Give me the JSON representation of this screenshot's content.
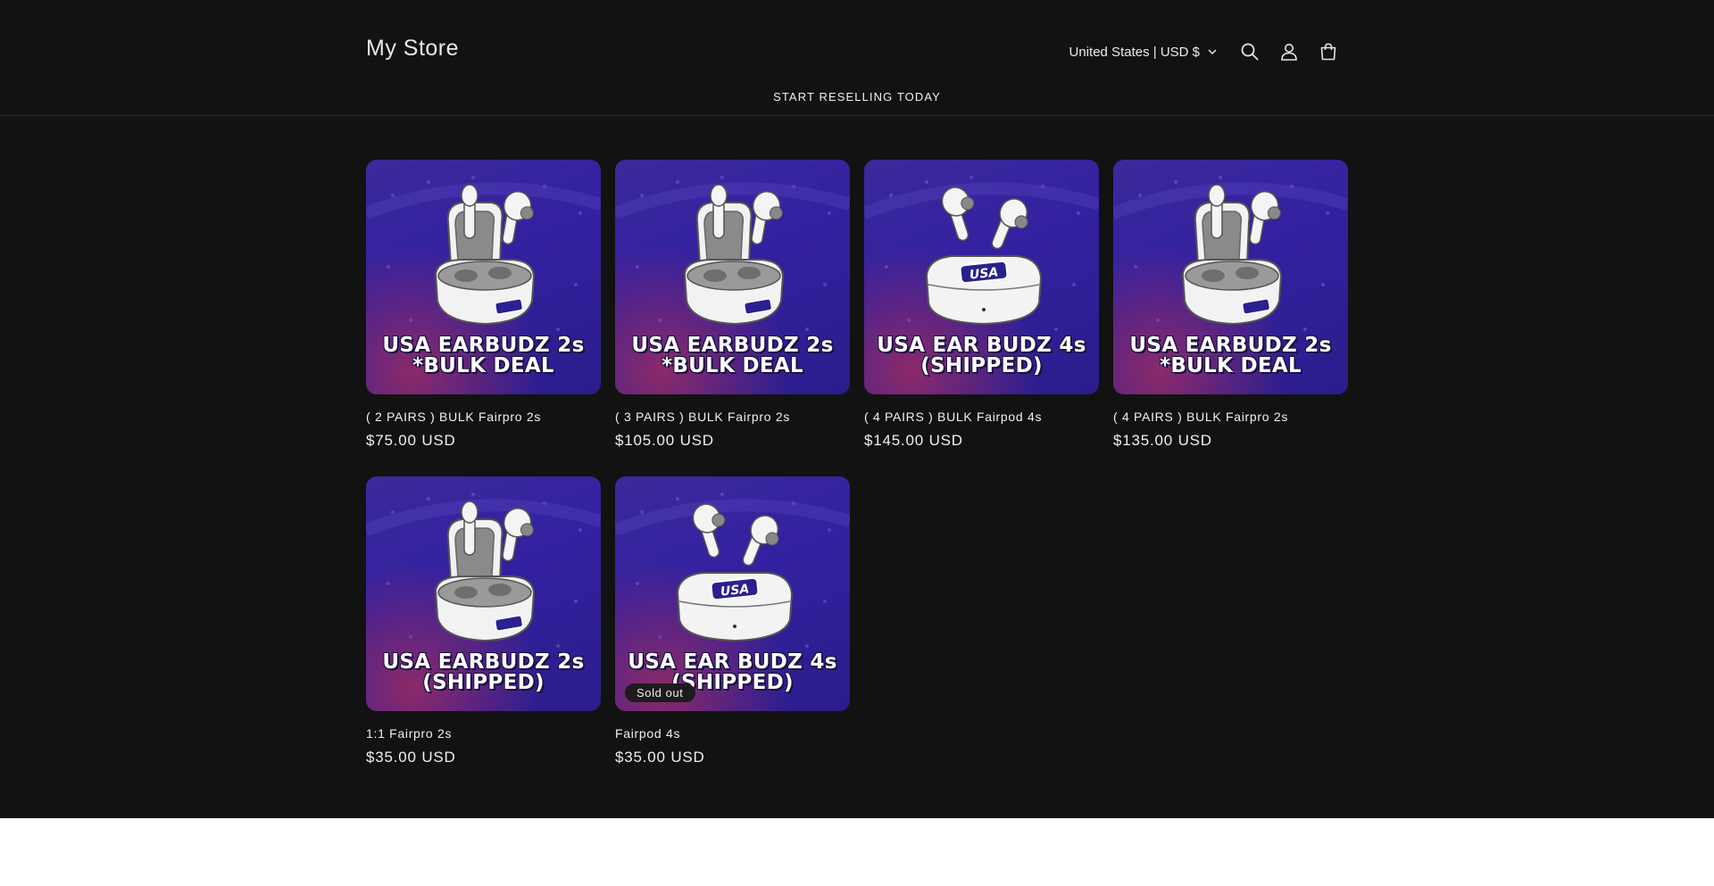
{
  "header": {
    "logo": "My Store",
    "country": "United States | USD $",
    "icons": [
      "search-icon",
      "account-icon",
      "cart-icon"
    ]
  },
  "nav": {
    "link": "START RESELLING TODAY"
  },
  "products": [
    {
      "title": "( 2 PAIRS ) BULK Fairpro 2s",
      "price": "$75.00 USD",
      "caption_line1": "USA EARBUDZ 2s",
      "caption_line2": "*BULK DEAL",
      "badge": ""
    },
    {
      "title": "( 3 PAIRS ) BULK Fairpro 2s",
      "price": "$105.00 USD",
      "caption_line1": "USA EARBUDZ 2s",
      "caption_line2": "*BULK DEAL",
      "badge": ""
    },
    {
      "title": "( 4 PAIRS ) BULK Fairpod 4s",
      "price": "$145.00 USD",
      "caption_line1": "USA EAR BUDZ 4s",
      "caption_line2": "(SHIPPED)",
      "badge": ""
    },
    {
      "title": "( 4 PAIRS ) BULK Fairpro 2s",
      "price": "$135.00 USD",
      "caption_line1": "USA EARBUDZ 2s",
      "caption_line2": "*BULK DEAL",
      "badge": ""
    },
    {
      "title": "1:1 Fairpro 2s",
      "price": "$35.00 USD",
      "caption_line1": "USA EARBUDZ 2s",
      "caption_line2": "(SHIPPED)",
      "badge": ""
    },
    {
      "title": "Fairpod 4s",
      "price": "$35.00 USD",
      "caption_line1": "USA EAR BUDZ 4s",
      "caption_line2": "(SHIPPED)",
      "badge": "Sold out"
    }
  ],
  "product_art": [
    "earbuds-open-case",
    "earbuds-open-case",
    "earbuds-closed-case-usa",
    "earbuds-open-case",
    "earbuds-open-case",
    "earbuds-closed-case-usa"
  ],
  "colors": {
    "background": "#121212",
    "card_purple": "#3321a0",
    "card_magenta": "#8b2a6a",
    "text": "#f0f0f0",
    "badge_bg": "#1c1c1c"
  }
}
